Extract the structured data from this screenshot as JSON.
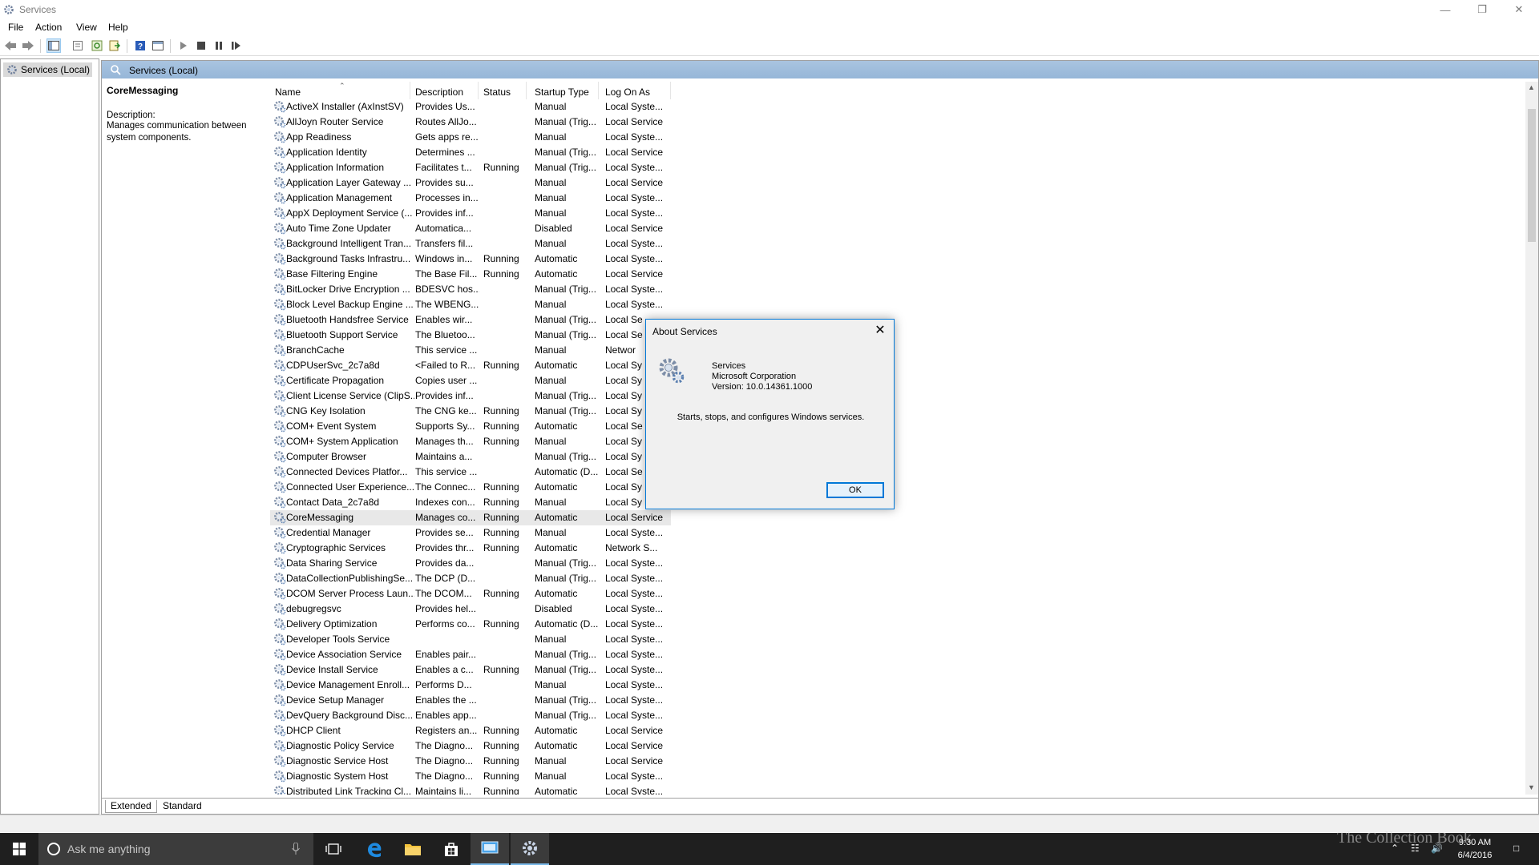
{
  "window": {
    "title": "Services",
    "minimize_icon": "minimize-icon",
    "restore_icon": "restore-icon",
    "close_icon": "close-icon"
  },
  "menu": [
    "File",
    "Action",
    "View",
    "Help"
  ],
  "toolbar_icons": [
    "back-icon",
    "forward-icon",
    "show-hide-console-tree-icon",
    "properties-icon",
    "refresh-icon",
    "export-list-icon",
    "help-icon",
    "show-hide-action-pane-icon",
    "start-service-icon",
    "stop-service-icon",
    "pause-service-icon",
    "restart-service-icon"
  ],
  "tree": {
    "root": "Services (Local)"
  },
  "pane": {
    "header": "Services (Local)"
  },
  "detail": {
    "service_name": "CoreMessaging",
    "description_label": "Description:",
    "description": "Manages communication between system components."
  },
  "columns": [
    "Name",
    "Description",
    "Status",
    "Startup Type",
    "Log On As"
  ],
  "services": [
    [
      "ActiveX Installer (AxInstSV)",
      "Provides Us...",
      "",
      "Manual",
      "Local Syste..."
    ],
    [
      "AllJoyn Router Service",
      "Routes AllJo...",
      "",
      "Manual (Trig...",
      "Local Service"
    ],
    [
      "App Readiness",
      "Gets apps re...",
      "",
      "Manual",
      "Local Syste..."
    ],
    [
      "Application Identity",
      "Determines ...",
      "",
      "Manual (Trig...",
      "Local Service"
    ],
    [
      "Application Information",
      "Facilitates t...",
      "Running",
      "Manual (Trig...",
      "Local Syste..."
    ],
    [
      "Application Layer Gateway ...",
      "Provides su...",
      "",
      "Manual",
      "Local Service"
    ],
    [
      "Application Management",
      "Processes in...",
      "",
      "Manual",
      "Local Syste..."
    ],
    [
      "AppX Deployment Service (...",
      "Provides inf...",
      "",
      "Manual",
      "Local Syste..."
    ],
    [
      "Auto Time Zone Updater",
      "Automatica...",
      "",
      "Disabled",
      "Local Service"
    ],
    [
      "Background Intelligent Tran...",
      "Transfers fil...",
      "",
      "Manual",
      "Local Syste..."
    ],
    [
      "Background Tasks Infrastru...",
      "Windows in...",
      "Running",
      "Automatic",
      "Local Syste..."
    ],
    [
      "Base Filtering Engine",
      "The Base Fil...",
      "Running",
      "Automatic",
      "Local Service"
    ],
    [
      "BitLocker Drive Encryption ...",
      "BDESVC hos...",
      "",
      "Manual (Trig...",
      "Local Syste..."
    ],
    [
      "Block Level Backup Engine ...",
      "The WBENG...",
      "",
      "Manual",
      "Local Syste..."
    ],
    [
      "Bluetooth Handsfree Service",
      "Enables wir...",
      "",
      "Manual (Trig...",
      "Local Se"
    ],
    [
      "Bluetooth Support Service",
      "The Bluetoo...",
      "",
      "Manual (Trig...",
      "Local Se"
    ],
    [
      "BranchCache",
      "This service ...",
      "",
      "Manual",
      "Networ"
    ],
    [
      "CDPUserSvc_2c7a8d",
      "<Failed to R...",
      "Running",
      "Automatic",
      "Local Sy"
    ],
    [
      "Certificate Propagation",
      "Copies user ...",
      "",
      "Manual",
      "Local Sy"
    ],
    [
      "Client License Service (ClipS...",
      "Provides inf...",
      "",
      "Manual (Trig...",
      "Local Sy"
    ],
    [
      "CNG Key Isolation",
      "The CNG ke...",
      "Running",
      "Manual (Trig...",
      "Local Sy"
    ],
    [
      "COM+ Event System",
      "Supports Sy...",
      "Running",
      "Automatic",
      "Local Se"
    ],
    [
      "COM+ System Application",
      "Manages th...",
      "Running",
      "Manual",
      "Local Sy"
    ],
    [
      "Computer Browser",
      "Maintains a...",
      "",
      "Manual (Trig...",
      "Local Sy"
    ],
    [
      "Connected Devices Platfor...",
      "This service ...",
      "",
      "Automatic (D...",
      "Local Se"
    ],
    [
      "Connected User Experience...",
      "The Connec...",
      "Running",
      "Automatic",
      "Local Sy"
    ],
    [
      "Contact Data_2c7a8d",
      "Indexes con...",
      "Running",
      "Manual",
      "Local Sy"
    ],
    [
      "CoreMessaging",
      "Manages co...",
      "Running",
      "Automatic",
      "Local Service"
    ],
    [
      "Credential Manager",
      "Provides se...",
      "Running",
      "Manual",
      "Local Syste..."
    ],
    [
      "Cryptographic Services",
      "Provides thr...",
      "Running",
      "Automatic",
      "Network S..."
    ],
    [
      "Data Sharing Service",
      "Provides da...",
      "",
      "Manual (Trig...",
      "Local Syste..."
    ],
    [
      "DataCollectionPublishingSe...",
      "The DCP (D...",
      "",
      "Manual (Trig...",
      "Local Syste..."
    ],
    [
      "DCOM Server Process Laun...",
      "The DCOM...",
      "Running",
      "Automatic",
      "Local Syste..."
    ],
    [
      "debugregsvc",
      "Provides hel...",
      "",
      "Disabled",
      "Local Syste..."
    ],
    [
      "Delivery Optimization",
      "Performs co...",
      "Running",
      "Automatic (D...",
      "Local Syste..."
    ],
    [
      "Developer Tools Service",
      "",
      "",
      "Manual",
      "Local Syste..."
    ],
    [
      "Device Association Service",
      "Enables pair...",
      "",
      "Manual (Trig...",
      "Local Syste..."
    ],
    [
      "Device Install Service",
      "Enables a c...",
      "Running",
      "Manual (Trig...",
      "Local Syste..."
    ],
    [
      "Device Management Enroll...",
      "Performs D...",
      "",
      "Manual",
      "Local Syste..."
    ],
    [
      "Device Setup Manager",
      "Enables the ...",
      "",
      "Manual (Trig...",
      "Local Syste..."
    ],
    [
      "DevQuery Background Disc...",
      "Enables app...",
      "",
      "Manual (Trig...",
      "Local Syste..."
    ],
    [
      "DHCP Client",
      "Registers an...",
      "Running",
      "Automatic",
      "Local Service"
    ],
    [
      "Diagnostic Policy Service",
      "The Diagno...",
      "Running",
      "Automatic",
      "Local Service"
    ],
    [
      "Diagnostic Service Host",
      "The Diagno...",
      "Running",
      "Manual",
      "Local Service"
    ],
    [
      "Diagnostic System Host",
      "The Diagno...",
      "Running",
      "Manual",
      "Local Syste..."
    ],
    [
      "Distributed Link Tracking Cl...",
      "Maintains li...",
      "Running",
      "Automatic",
      "Local Syste..."
    ]
  ],
  "selected_index": 27,
  "tabs": [
    "Extended",
    "Standard"
  ],
  "active_tab": "Extended",
  "dialog": {
    "title": "About Services",
    "product": "Services",
    "company": "Microsoft Corporation",
    "version": "Version: 10.0.14361.1000",
    "message": "Starts, stops, and configures Windows services.",
    "ok_label": "OK"
  },
  "taskbar": {
    "search_placeholder": "Ask me anything",
    "time": "9:30 AM",
    "date": "6/4/2016",
    "watermark": "The Collection Book"
  },
  "colors": {
    "pane_header": "#a9c4e0",
    "selection": "#e8e8e8",
    "taskbar": "#1f1f1f",
    "accent": "#0078d7"
  }
}
